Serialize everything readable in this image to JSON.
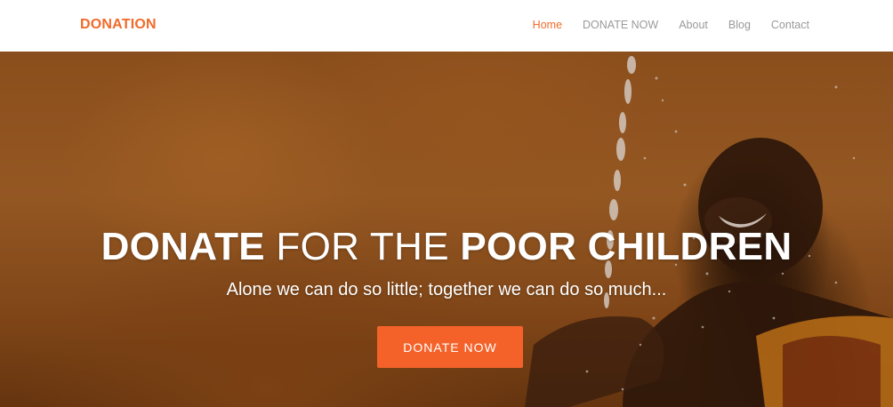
{
  "brand": {
    "name": "DONATION",
    "color": "#f26a2a"
  },
  "nav": {
    "items": [
      {
        "label": "Home",
        "active": true
      },
      {
        "label": "DONATE NOW",
        "active": false
      },
      {
        "label": "About",
        "active": false
      },
      {
        "label": "Blog",
        "active": false
      },
      {
        "label": "Contact",
        "active": false
      }
    ],
    "active_color": "#f26a2a",
    "inactive_color": "#9a9a9a"
  },
  "hero": {
    "title_part1": "DONATE",
    "title_part2": " FOR THE ",
    "title_part3": "POOR CHILDREN",
    "subtitle": "Alone we can do so little; together we can do so much...",
    "button_label": "DONATE NOW",
    "button_color": "#f4622a",
    "background_image": "child-water-splash-photo"
  }
}
